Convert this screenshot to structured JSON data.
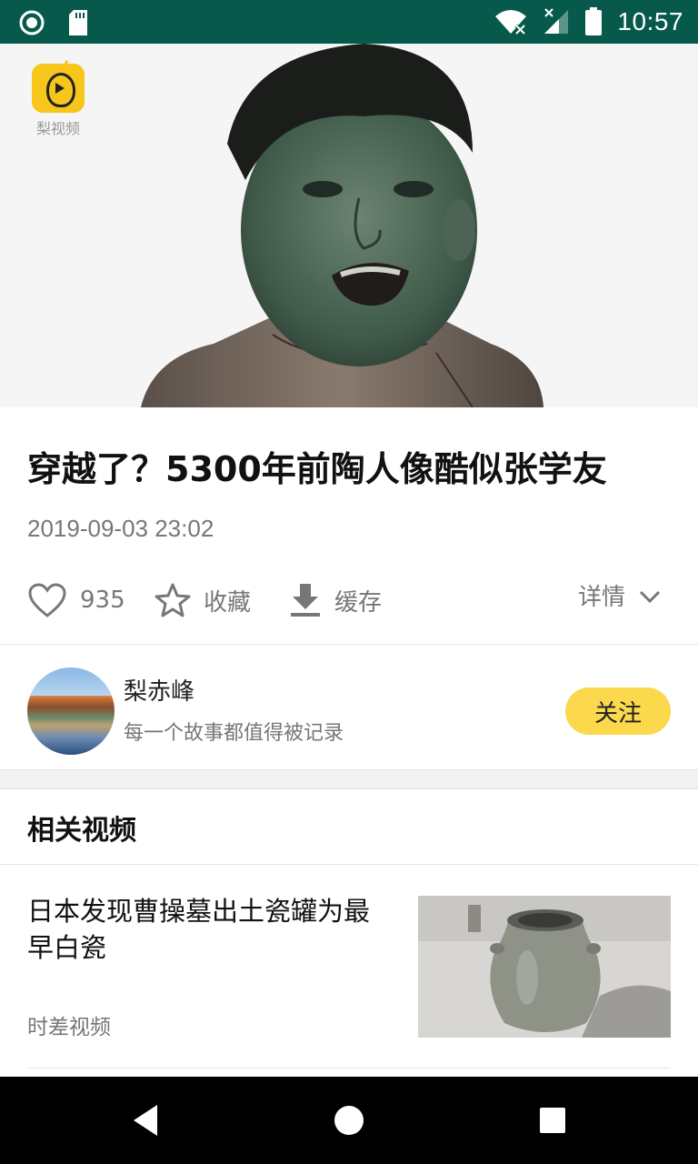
{
  "status_bar": {
    "time": "10:57",
    "icons": [
      "record-icon",
      "sd-card-icon",
      "wifi-icon",
      "signal-icon",
      "battery-icon"
    ],
    "background": "#075a4b"
  },
  "video": {
    "logo_text": "梨视频",
    "logo_color": "#f7c61a"
  },
  "article": {
    "title": "穿越了？5300年前陶人像酷似张学友",
    "date": "2019-09-03 23:02"
  },
  "actions": {
    "likes": "935",
    "favorite_label": "收藏",
    "download_label": "缓存",
    "details_label": "详情"
  },
  "author": {
    "name": "梨赤峰",
    "description": "每一个故事都值得被记录",
    "follow_label": "关注",
    "follow_color": "#fbd84c"
  },
  "related": {
    "heading": "相关视频",
    "items": [
      {
        "title": "日本发现曹操墓出土瓷罐为最早白瓷",
        "source": "时差视频"
      }
    ]
  }
}
